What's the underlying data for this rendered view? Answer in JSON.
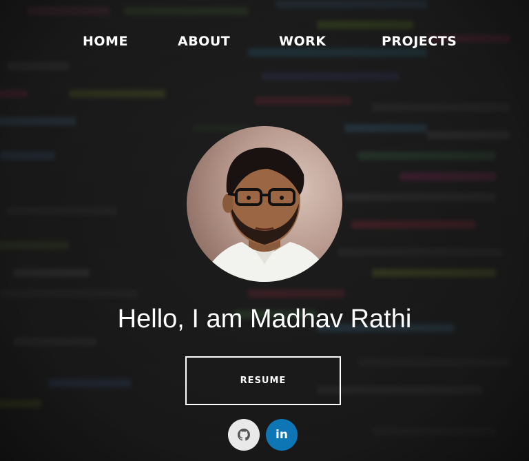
{
  "nav": {
    "items": [
      {
        "label": "HOME"
      },
      {
        "label": "ABOUT"
      },
      {
        "label": "WORK"
      },
      {
        "label": "PROJECTS"
      }
    ]
  },
  "profile": {
    "headline": "Hello, I am Madhav Rathi",
    "avatar_icon": "profile-photo"
  },
  "actions": {
    "resume_label": "RESUME"
  },
  "social": {
    "github_icon": "github-icon",
    "linkedin_label": "in",
    "linkedin_color": "#0e76b5",
    "github_color": "#e9e9e9"
  },
  "theme": {
    "text": "#ffffff",
    "background": "#1a1a1a"
  }
}
